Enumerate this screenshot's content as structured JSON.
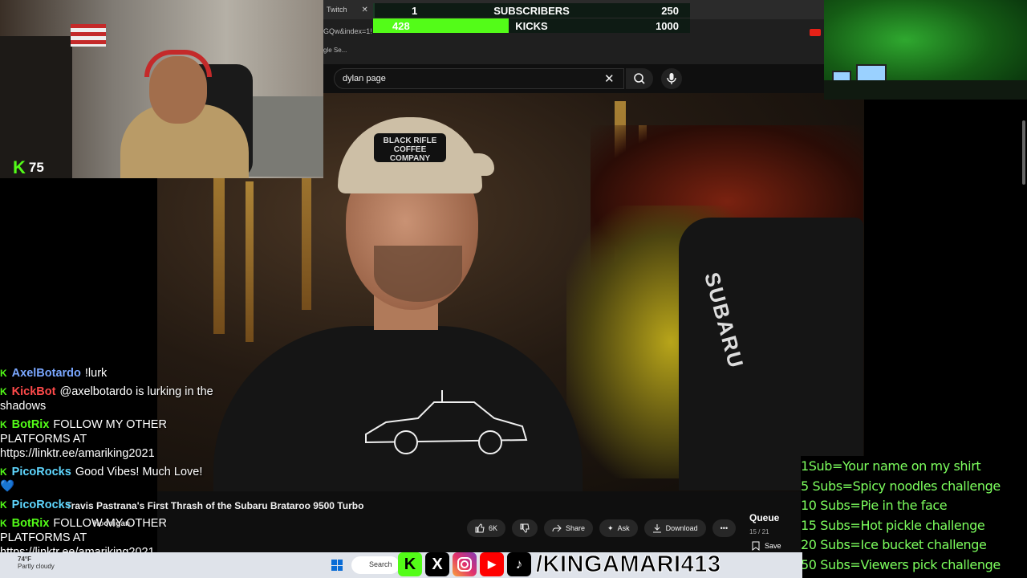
{
  "browser": {
    "tab_label": "Twitch",
    "tab_close": "✕",
    "tab_new": "+",
    "address_fragment": "GQw&index=1!",
    "bookmark_fragment": "gle Se..."
  },
  "goals_bar": {
    "subs_current": "1",
    "subs_label": "SUBSCRIBERS",
    "subs_target": "250",
    "subs_fraction": 0.004,
    "kicks_current": "428",
    "kicks_label": "KICKS",
    "kicks_target": "1000",
    "kicks_fraction": 0.428
  },
  "search": {
    "query": "dylan page",
    "clear_glyph": "✕"
  },
  "video": {
    "title": "Travis Pastrana's First Thrash of the Subaru Brataroo 9500 Turbo",
    "cap_text": "BLACK RIFLE COFFEE COMPANY",
    "shirt_text": "SUBARU",
    "channel": "Hoonigan",
    "likes": "6K",
    "share_label": "Share",
    "ask_label": "Ask",
    "download_label": "Download",
    "more_label": "•••"
  },
  "queue": {
    "title": "Queue",
    "count": "15 / 21",
    "save_label": "Save"
  },
  "webcam": {
    "kick_viewers": "75",
    "kick_glyph": "K"
  },
  "chat": [
    {
      "user": "AxelBotardo",
      "color": "#7aa7ff",
      "text": "!lurk"
    },
    {
      "user": "KickBot",
      "color": "#ff4a4a",
      "text": "@axelbotardo is lurking in the shadows"
    },
    {
      "user": "BotRix",
      "color": "#53fc18",
      "text": "FOLLOW MY OTHER PLATFORMS AT https://linktr.ee/amariking2021"
    },
    {
      "user": "PicoRocks",
      "color": "#5fd7ff",
      "text": "Good Vibes! Much Love! 💙"
    },
    {
      "user": "PicoRocks",
      "color": "#5fd7ff",
      "text": ""
    },
    {
      "user": "BotRix",
      "color": "#53fc18",
      "text": "FOLLOW MY OTHER PLATFORMS AT https://linktr.ee/amariking2021"
    }
  ],
  "chat_badge": "K",
  "sub_goals": [
    "1Sub=Your name on my shirt",
    "5 Subs=Spicy noodles challenge",
    "10 Subs=Pie in the face",
    "15 Subs=Hot pickle challenge",
    "20 Subs=Ice bucket challenge",
    "50 Subs=Viewers pick challenge"
  ],
  "taskbar": {
    "weather_temp": "74°F",
    "weather_desc": "Partly cloudy",
    "search_label": "Search"
  },
  "social": {
    "handle": "/KINGAMARI413",
    "kick_glyph": "K",
    "x_glyph": "X",
    "tiktok_glyph": "♪"
  },
  "colors": {
    "kick_green": "#53fc18",
    "goal_text_green": "#7dff5e"
  }
}
